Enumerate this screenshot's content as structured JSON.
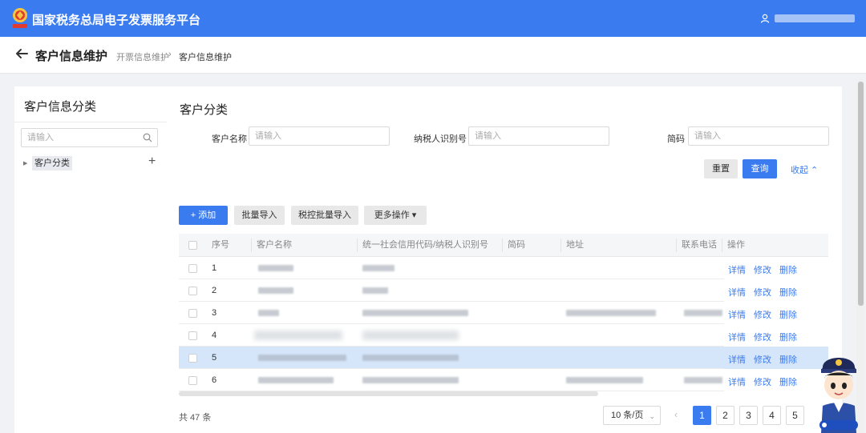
{
  "app": {
    "title": "国家税务总局电子发票服务平台"
  },
  "header": {
    "title": "客户信息维护",
    "breadcrumb": [
      "开票信息维护",
      "客户信息维护"
    ],
    "separator": "›"
  },
  "sidebar": {
    "title": "客户信息分类",
    "search_placeholder": "请输入",
    "tree_root": "客户分类",
    "add_symbol": "+"
  },
  "main": {
    "section_title": "客户分类",
    "filters": [
      {
        "label": "客户名称",
        "placeholder": "请输入"
      },
      {
        "label": "纳税人识别号",
        "placeholder": "请输入"
      },
      {
        "label": "简码",
        "placeholder": "请输入"
      }
    ],
    "reset_label": "重置",
    "query_label": "查询",
    "collapse_label": "收起 ⌃",
    "toolbar": {
      "add_label": "+ 添加",
      "batch_import_label": "批量导入",
      "tax_batch_import_label": "税控批量导入",
      "more_label": "更多操作 ▾"
    },
    "columns": [
      "序号",
      "客户名称",
      "统一社会信用代码/纳税人识别号",
      "简码",
      "地址",
      "联系电话",
      "操作"
    ],
    "rows": [
      {
        "index": "1",
        "selected": false
      },
      {
        "index": "2",
        "selected": false
      },
      {
        "index": "3",
        "selected": false
      },
      {
        "index": "4",
        "selected": false
      },
      {
        "index": "5",
        "selected": true
      },
      {
        "index": "6",
        "selected": false
      }
    ],
    "row_actions": [
      "详情",
      "修改",
      "删除"
    ],
    "total_text": "共 47 条",
    "page_size": "10 条/页",
    "page_size_chevron": "⌄",
    "prev_symbol": "‹",
    "pages": [
      "1",
      "2",
      "3",
      "4",
      "5"
    ],
    "current_page": "1"
  },
  "colors": {
    "primary": "#3a7bf0",
    "selected_row": "#d6e6fa"
  }
}
